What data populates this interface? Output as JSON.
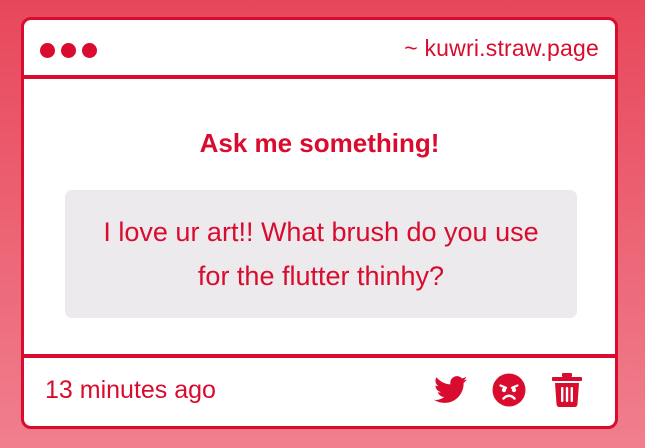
{
  "window": {
    "url": "~ kuwri.straw.page"
  },
  "main": {
    "heading": "Ask me something!",
    "question": "I love ur art!! What brush do you use for the flutter thinhy?"
  },
  "footer": {
    "timestamp": "13 minutes ago",
    "icons": [
      "twitter-icon",
      "angry-face-icon",
      "trash-icon"
    ]
  },
  "colors": {
    "accent": "#d90b2e",
    "question_background": "#eceaec",
    "page_gradient_top": "#e8475b",
    "page_gradient_bottom": "#f07f8d"
  }
}
